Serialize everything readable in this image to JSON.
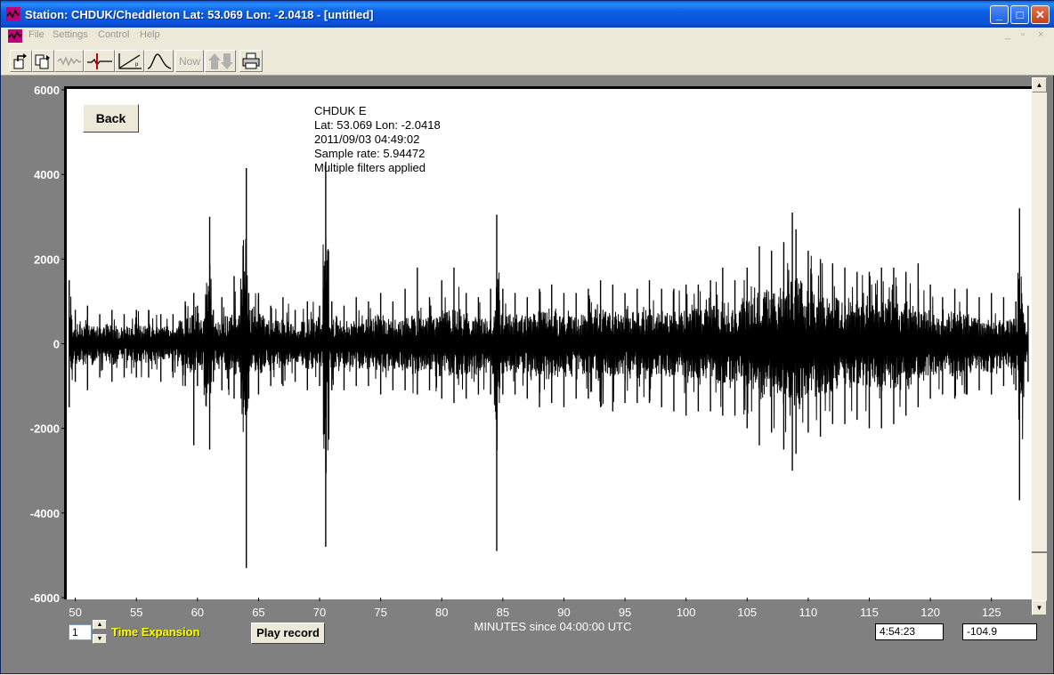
{
  "window": {
    "title": "Station: CHDUK/Cheddleton Lat: 53.069 Lon: -2.0418 - [untitled]",
    "controls": {
      "minimize": "_",
      "maximize": "□",
      "close": "✕"
    }
  },
  "menu": {
    "items": [
      "File",
      "Settings",
      "Control",
      "Help"
    ],
    "mdi_controls": [
      "_",
      "▫",
      "×"
    ]
  },
  "toolbar": {
    "buttons": [
      {
        "name": "open-export-icon"
      },
      {
        "name": "copy-export-icon"
      },
      {
        "name": "waveform-icon"
      },
      {
        "name": "pick-marker-icon"
      },
      {
        "name": "trend-graph-icon"
      },
      {
        "name": "spectrum-curve-icon"
      },
      {
        "name": "now",
        "label": "Now"
      },
      {
        "name": "up-down-arrows-icon"
      },
      {
        "name": "printer-icon"
      }
    ]
  },
  "plot": {
    "back_label": "Back",
    "info": {
      "station": "CHDUK  E",
      "coords": "Lat: 53.069 Lon: -2.0418",
      "datetime": "2011/09/03 04:49:02",
      "sample_rate": "Sample rate: 5.94472",
      "filters": "Multiple filters applied"
    },
    "colors": {
      "plot_bg": "#ffffff",
      "trace": "#000000",
      "frame_bg": "#808080"
    }
  },
  "chart_data": {
    "type": "line",
    "title": "",
    "xlabel": "MINUTES since 04:00:00 UTC",
    "ylabel": "",
    "xlim": [
      49.3,
      128.3
    ],
    "ylim": [
      -6000,
      6000
    ],
    "x_ticks": [
      50,
      55,
      60,
      65,
      70,
      75,
      80,
      85,
      90,
      95,
      100,
      105,
      110,
      115,
      120,
      125
    ],
    "y_ticks": [
      6000,
      4000,
      2000,
      0,
      -2000,
      -4000,
      -6000
    ],
    "series": [
      {
        "values_description_free": true,
        "x": [
          49.5,
          50.0,
          51.0,
          52.0,
          53.0,
          54.0,
          55.0,
          56.0,
          57.0,
          58.0,
          59.0,
          59.7,
          60.0,
          61.0,
          61.3,
          62.0,
          63.0,
          64.0,
          64.2,
          65.0,
          66.0,
          67.0,
          68.0,
          69.0,
          70.0,
          70.5,
          71.0,
          72.0,
          73.0,
          74.0,
          75.0,
          76.0,
          77.0,
          78.0,
          79.0,
          80.0,
          81.0,
          82.0,
          83.0,
          84.0,
          84.5,
          85.0,
          86.0,
          87.0,
          88.0,
          89.0,
          90.0,
          91.0,
          92.0,
          93.0,
          94.0,
          95.0,
          96.0,
          97.0,
          98.0,
          99.0,
          100.0,
          101.0,
          102.0,
          103.0,
          104.0,
          105.0,
          106.0,
          107.0,
          108.0,
          108.7,
          109.0,
          110.0,
          111.0,
          112.0,
          113.0,
          114.0,
          115.0,
          116.0,
          117.0,
          118.0,
          119.0,
          120.0,
          121.0,
          122.0,
          123.0,
          124.0,
          125.0,
          126.0,
          127.0,
          127.3,
          128.0
        ],
        "y_max": [
          1500,
          800,
          900,
          700,
          800,
          700,
          800,
          800,
          700,
          700,
          1000,
          1200,
          900,
          3000,
          800,
          1100,
          1600,
          4150,
          1200,
          1200,
          900,
          1100,
          800,
          1000,
          900,
          4300,
          1000,
          900,
          1100,
          1000,
          1200,
          1000,
          1300,
          1800,
          1100,
          1500,
          1800,
          1200,
          1100,
          1300,
          3050,
          1300,
          1200,
          1100,
          1300,
          1400,
          1200,
          1200,
          1300,
          1500,
          1400,
          1200,
          1300,
          1500,
          1300,
          1300,
          1400,
          1400,
          1500,
          1800,
          1500,
          1800,
          2300,
          2200,
          2400,
          3100,
          2700,
          2200,
          2000,
          1900,
          1800,
          1700,
          1700,
          1800,
          1800,
          1700,
          1900,
          1400,
          1100,
          1300,
          1300,
          1100,
          1200,
          1100,
          1000,
          3200,
          900
        ],
        "y_min": [
          -1500,
          -900,
          -1100,
          -800,
          -900,
          -800,
          -800,
          -800,
          -900,
          -800,
          -1000,
          -2400,
          -1000,
          -2500,
          -900,
          -1100,
          -1300,
          -5300,
          -1300,
          -1200,
          -1000,
          -1000,
          -900,
          -1100,
          -1000,
          -4800,
          -1100,
          -1100,
          -1000,
          -1000,
          -1200,
          -1100,
          -1100,
          -1200,
          -1100,
          -1300,
          -1400,
          -1300,
          -1200,
          -1200,
          -4900,
          -1200,
          -1200,
          -1300,
          -1500,
          -1400,
          -1500,
          -1300,
          -1300,
          -1500,
          -1600,
          -1400,
          -1400,
          -1400,
          -1500,
          -1600,
          -1700,
          -1600,
          -1600,
          -1700,
          -1700,
          -2000,
          -2400,
          -2100,
          -2500,
          -3000,
          -2600,
          -2100,
          -2200,
          -1900,
          -1900,
          -1800,
          -2000,
          -2000,
          -1900,
          -1700,
          -1500,
          -1300,
          -1200,
          -1300,
          -1200,
          -1100,
          -1200,
          -1000,
          -1100,
          -3700,
          -900
        ]
      }
    ],
    "legend": "none",
    "grid": false
  },
  "bottom": {
    "expansion_value": "1",
    "expansion_label": "Time Expansion",
    "play_label": "Play record",
    "axis_title": "MINUTES since 04:00:00 UTC",
    "time_readout": "4:54:23",
    "value_readout": "-104.9"
  }
}
